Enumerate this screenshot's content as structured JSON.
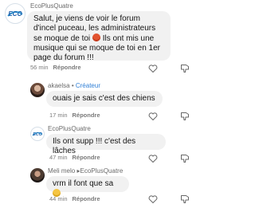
{
  "comments": [
    {
      "author": "EcoPlusQuatre",
      "badge": "",
      "reply_to": "",
      "text_before_emoji": "Salut, je viens de voir le forum d'incel puceau, les administrateurs se moque de toi ",
      "emoji": "angry-face-emoji",
      "text_after_emoji": " Ils ont mis une musique qui se moque de toi en 1er page du forum !!!",
      "time": "56 min",
      "reply_label": "Répondre"
    },
    {
      "author": "akaelsa",
      "badge": "Créateur",
      "reply_to": "",
      "text": "ouais je sais c'est des chiens",
      "time": "17 min",
      "reply_label": "Répondre"
    },
    {
      "author": "EcoPlusQuatre",
      "badge": "",
      "reply_to": "",
      "text": "Ils ont supp !!! c'est des lâches",
      "time": "47 min",
      "reply_label": "Répondre"
    },
    {
      "author": "Meli melo",
      "badge": "",
      "reply_to": "EcoPlusQuatre",
      "text_before_emoji": "vrm il font que sa ",
      "emoji": "crying-face-emoji",
      "time": "44 min",
      "reply_label": "Répondre"
    }
  ],
  "separator_dot": "•",
  "reply_arrow": "▸",
  "logo_text": "ECO",
  "colors": {
    "bubble": "#f1f1f1",
    "creator": "#2f7fd6",
    "meta": "#7a7a7a"
  },
  "icons": [
    "heart-outline-icon",
    "thumbs-down-outline-icon"
  ]
}
